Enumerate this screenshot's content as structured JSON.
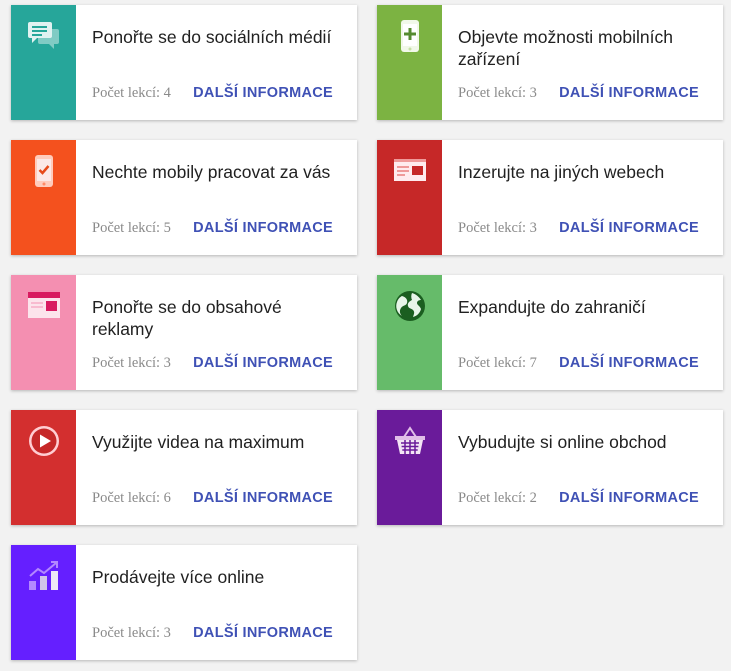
{
  "cards": [
    {
      "title": "Ponořte se do sociálních médií",
      "lessons": "Počet lekcí: 4",
      "link": "DALŠÍ INFORMACE",
      "color": "#26a69a",
      "icon": "chat-bubbles-icon"
    },
    {
      "title": "Objevte možnosti mobilních zařízení",
      "lessons": "Počet lekcí: 3",
      "link": "DALŠÍ INFORMACE",
      "color": "#7cb342",
      "icon": "mobile-plus-icon"
    },
    {
      "title": "Nechte mobily pracovat za vás",
      "lessons": "Počet lekcí: 5",
      "link": "DALŠÍ INFORMACE",
      "color": "#f4511e",
      "icon": "mobile-check-icon"
    },
    {
      "title": "Inzerujte na jiných webech",
      "lessons": "Počet lekcí: 3",
      "link": "DALŠÍ INFORMACE",
      "color": "#c62828",
      "icon": "browser-ad-icon"
    },
    {
      "title": "Ponořte se do obsahové reklamy",
      "lessons": "Počet lekcí: 3",
      "link": "DALŠÍ INFORMACE",
      "color": "#f48fb1",
      "icon": "display-ad-icon"
    },
    {
      "title": "Expandujte do zahraničí",
      "lessons": "Počet lekcí: 7",
      "link": "DALŠÍ INFORMACE",
      "color": "#66bb6a",
      "icon": "globe-icon"
    },
    {
      "title": "Využijte videa na maximum",
      "lessons": "Počet lekcí: 6",
      "link": "DALŠÍ INFORMACE",
      "color": "#d32f2f",
      "icon": "play-video-icon"
    },
    {
      "title": "Vybudujte si online obchod",
      "lessons": "Počet lekcí: 2",
      "link": "DALŠÍ INFORMACE",
      "color": "#6a1b9a",
      "icon": "shopping-basket-icon"
    },
    {
      "title": "Prodávejte více online",
      "lessons": "Počet lekcí: 3",
      "link": "DALŠÍ INFORMACE",
      "color": "#651fff",
      "icon": "growth-chart-icon"
    }
  ]
}
